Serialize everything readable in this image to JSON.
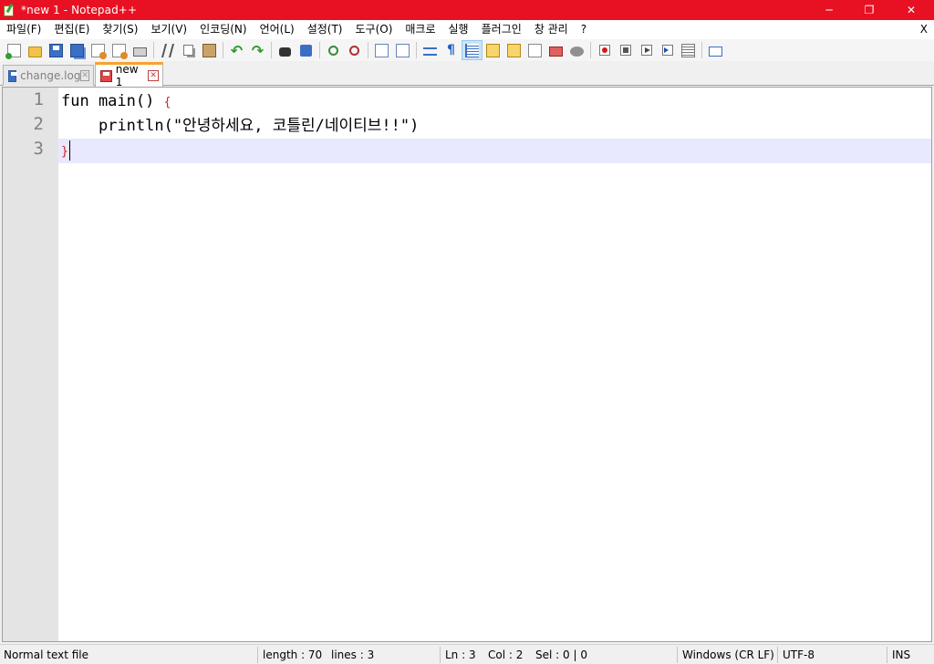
{
  "window": {
    "title": "*new 1 - Notepad++",
    "controls": {
      "minimize": "─",
      "maximize": "❐",
      "close": "✕"
    },
    "accent_color": "#e81123"
  },
  "menubar": {
    "items": [
      "파일(F)",
      "편집(E)",
      "찾기(S)",
      "보기(V)",
      "인코딩(N)",
      "언어(L)",
      "설정(T)",
      "도구(O)",
      "매크로",
      "실행",
      "플러그인",
      "창 관리",
      "?"
    ],
    "close_label": "X"
  },
  "toolbar": {
    "icons": [
      "new-file-icon",
      "open-file-icon",
      "save-icon",
      "save-all-icon",
      "close-file-icon",
      "close-all-icon",
      "print-icon",
      "cut-icon",
      "copy-icon",
      "paste-icon",
      "undo-icon",
      "redo-icon",
      "find-icon",
      "replace-icon",
      "zoom-in-icon",
      "zoom-out-icon",
      "sync-vertical-icon",
      "sync-horizontal-icon",
      "word-wrap-icon",
      "show-all-chars-icon",
      "indent-guide-icon",
      "language-define-icon",
      "document-map-icon",
      "function-list-icon",
      "folder-workspace-icon",
      "monitoring-icon",
      "record-macro-icon",
      "stop-recording-icon",
      "playback-icon",
      "run-macro-multiple-icon",
      "save-macro-icon",
      "run-command-icon"
    ]
  },
  "tabs": [
    {
      "label": "change.log",
      "active": false
    },
    {
      "label": "new 1",
      "active": true
    }
  ],
  "editor": {
    "line_numbers": [
      "1",
      "2",
      "3"
    ],
    "lines": [
      {
        "text": "fun main() ",
        "brace": "{"
      },
      {
        "text": "    println(\"안녕하세요, 코틀린/네이티브!!\")",
        "brace": ""
      },
      {
        "text": "",
        "brace": "}"
      }
    ],
    "current_line": 3
  },
  "statusbar": {
    "file_type": "Normal text file",
    "length": "length : 70",
    "lines": "lines : 3",
    "ln": "Ln : 3",
    "col": "Col : 2",
    "sel": "Sel : 0 | 0",
    "eol": "Windows (CR LF)",
    "encoding": "UTF-8",
    "mode": "INS"
  }
}
